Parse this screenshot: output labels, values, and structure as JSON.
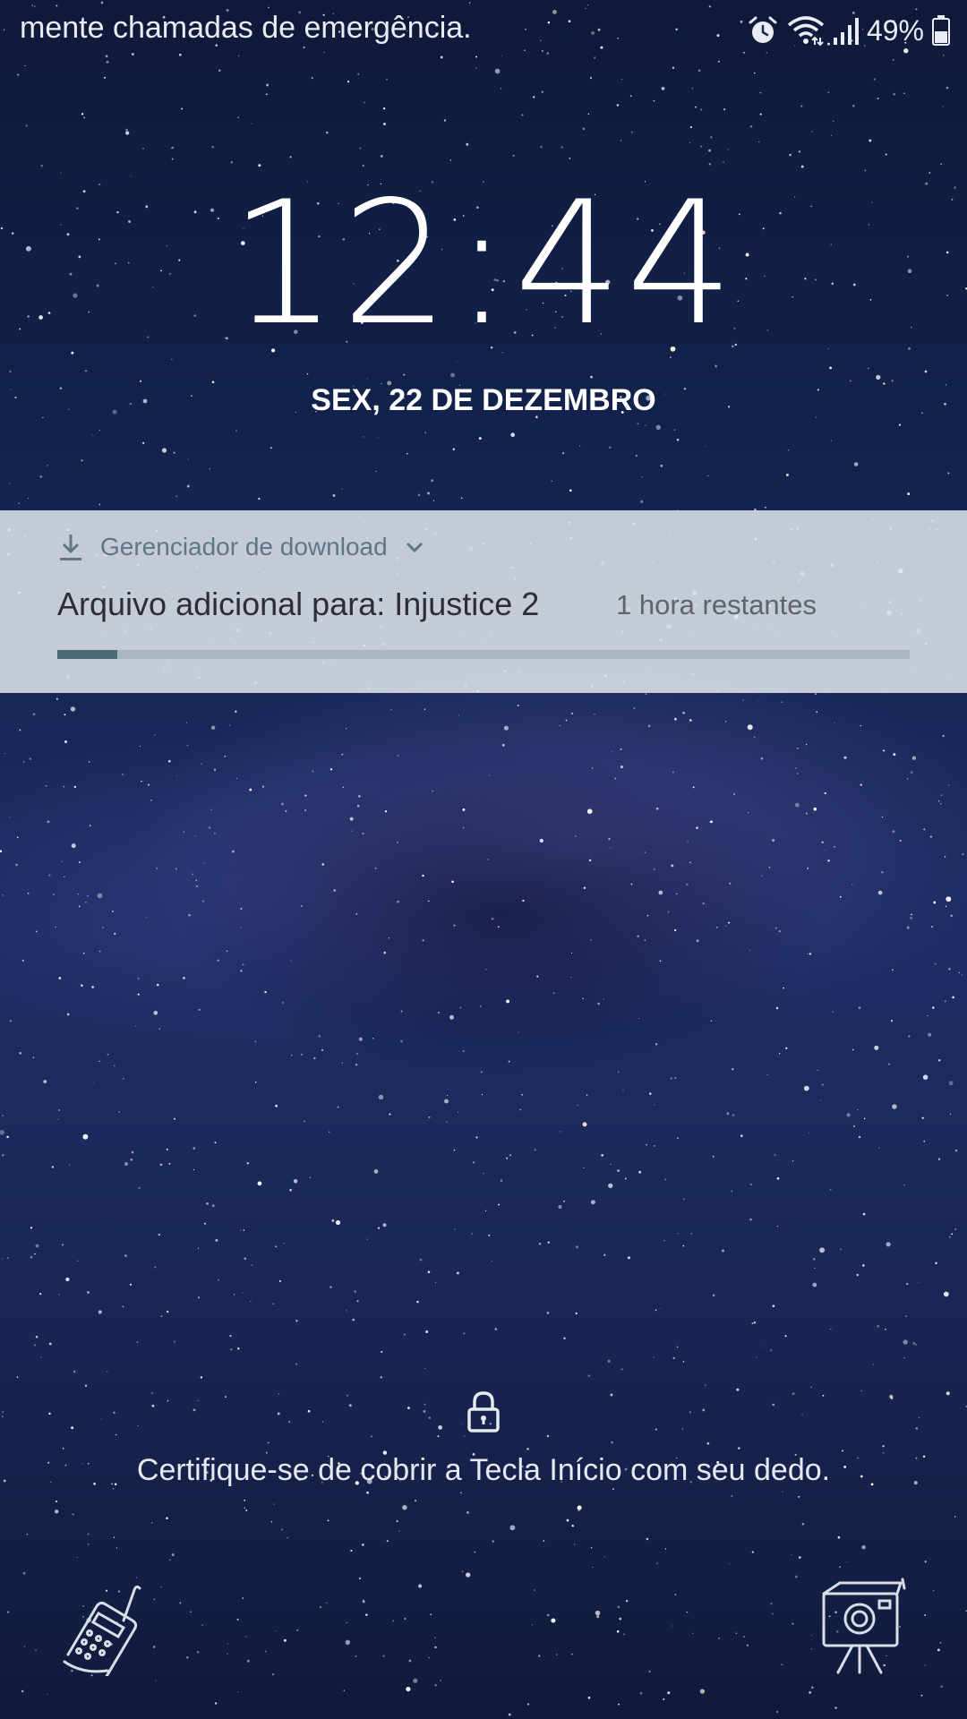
{
  "status_bar": {
    "carrier_text": "mente chamadas de emergência.",
    "battery_percent": "49%",
    "icons": [
      "alarm-icon",
      "wifi-icon",
      "signal-icon",
      "battery-icon"
    ]
  },
  "lockscreen": {
    "time": "12:44",
    "date": "SEX, 22 DE DEZEMBRO",
    "hint": "Certifique-se de cobrir a Tecla Início com seu dedo.",
    "left_shortcut_icon": "phone-icon",
    "right_shortcut_icon": "camera-icon"
  },
  "notification": {
    "app_name": "Gerenciador de download",
    "app_icon": "download-icon",
    "expand_icon": "chevron-down-icon",
    "title": "Arquivo adicional para: Injustice 2",
    "subtitle": "1 hora restantes",
    "progress": 0.07
  },
  "colors": {
    "notification_bg": "#e2e6ec",
    "accent": "#5d7784",
    "progress_fill": "#4b6b79",
    "progress_track": "#a8b6bd"
  }
}
